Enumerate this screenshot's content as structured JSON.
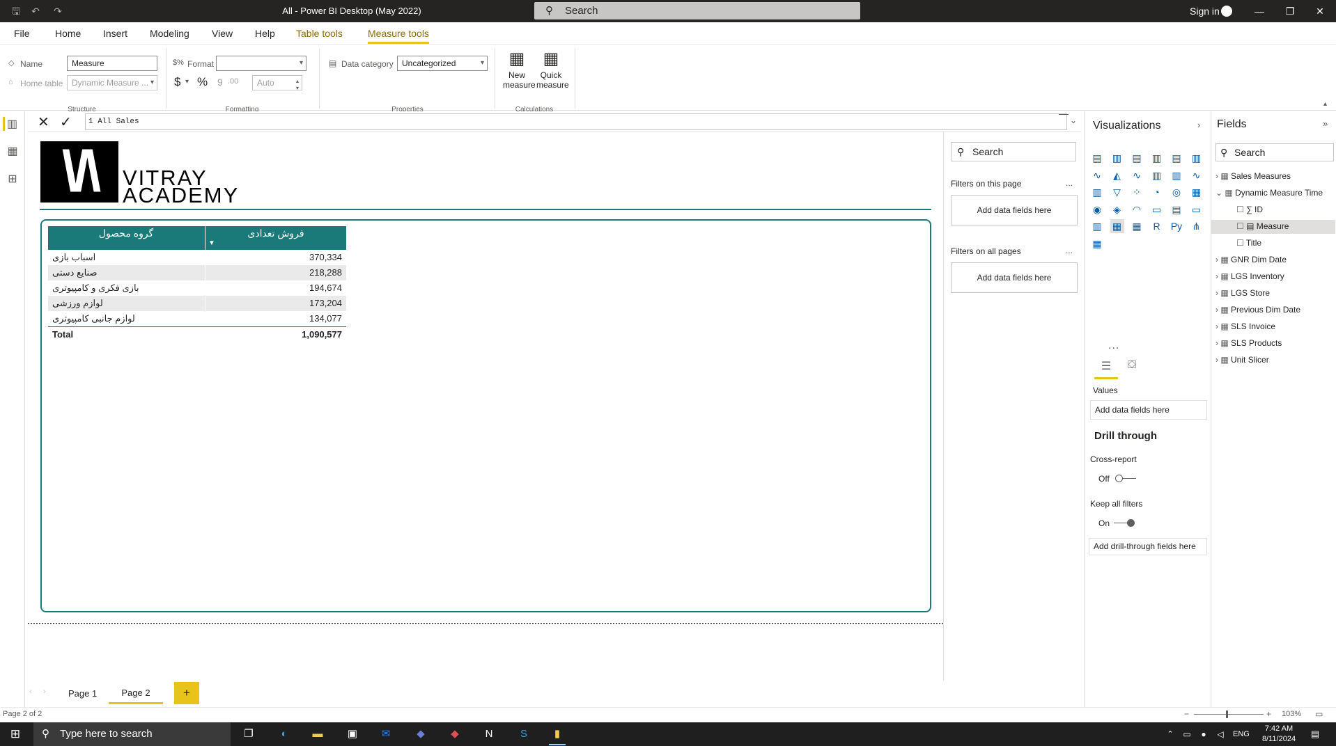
{
  "window": {
    "title": "All - Power BI Desktop (May 2022)",
    "search_placeholder": "Search",
    "sign_in": "Sign in",
    "minimize": "—",
    "restore": "❐",
    "close": "✕"
  },
  "ribbon_tabs": [
    "File",
    "Home",
    "Insert",
    "Modeling",
    "View",
    "Help",
    "Table tools",
    "Measure tools"
  ],
  "ribbon": {
    "name_label": "Name",
    "name_value": "Measure",
    "home_table_label": "Home table",
    "home_table_value": "Dynamic Measure ...",
    "structure_group": "Structure",
    "format_label": "Format",
    "format_value": "",
    "currency_symbol": "$",
    "percent_symbol": "%",
    "comma_symbol": "9",
    "decimals_symbol": ".00",
    "auto_value": "Auto",
    "formatting_group": "Formatting",
    "data_category_label": "Data category",
    "data_category_value": "Uncategorized",
    "properties_group": "Properties",
    "new_measure_line1": "New",
    "new_measure_line2": "measure",
    "quick_measure_line1": "Quick",
    "quick_measure_line2": "measure",
    "calculations_group": "Calculations"
  },
  "formula": {
    "text": "1 All Sales"
  },
  "canvas": {
    "logo_mark": "\\/\\",
    "logo_line1": "VITRAY",
    "logo_line2": "ACADEMY"
  },
  "table": {
    "headers": [
      "گروه محصول",
      "فروش تعدادی"
    ],
    "rows": [
      {
        "group": "اسباب بازی",
        "value": "370,334"
      },
      {
        "group": "صنایع دستی",
        "value": "218,288"
      },
      {
        "group": "بازی فکری و کامپیوتری",
        "value": "194,674"
      },
      {
        "group": "لوازم ورزشی",
        "value": "173,204"
      },
      {
        "group": "لوازم جانبی کامپیوتری",
        "value": "134,077"
      }
    ],
    "total_label": "Total",
    "total_value": "1,090,577"
  },
  "filters": {
    "search_placeholder": "Search",
    "on_this_page": "Filters on this page",
    "on_all_pages": "Filters on all pages",
    "add_fields": "Add data fields here",
    "more": "..."
  },
  "visualizations": {
    "title": "Visualizations",
    "more": "...",
    "values_label": "Values",
    "values_add": "Add data fields here",
    "drill_title": "Drill through",
    "cross_report_label": "Cross-report",
    "cross_report_state": "Off",
    "keep_filters_label": "Keep all filters",
    "keep_filters_state": "On",
    "drill_add": "Add drill-through fields here"
  },
  "fields": {
    "title": "Fields",
    "search_placeholder": "Search",
    "tables": [
      "Sales Measures",
      "Dynamic Measure Time",
      "GNR Dim Date",
      "LGS Inventory",
      "LGS Store",
      "Previous Dim Date",
      "SLS Invoice",
      "SLS Products",
      "Unit Slicer"
    ],
    "expanded_fields": [
      "ID",
      "Measure",
      "Title"
    ]
  },
  "pages": {
    "tabs": [
      "Page 1",
      "Page 2"
    ],
    "add": "+",
    "status": "Page 2 of 2",
    "zoom": "103%"
  },
  "taskbar": {
    "search_placeholder": "Type here to search",
    "language": "ENG",
    "time": "7:42 AM",
    "date": "8/11/2024"
  }
}
